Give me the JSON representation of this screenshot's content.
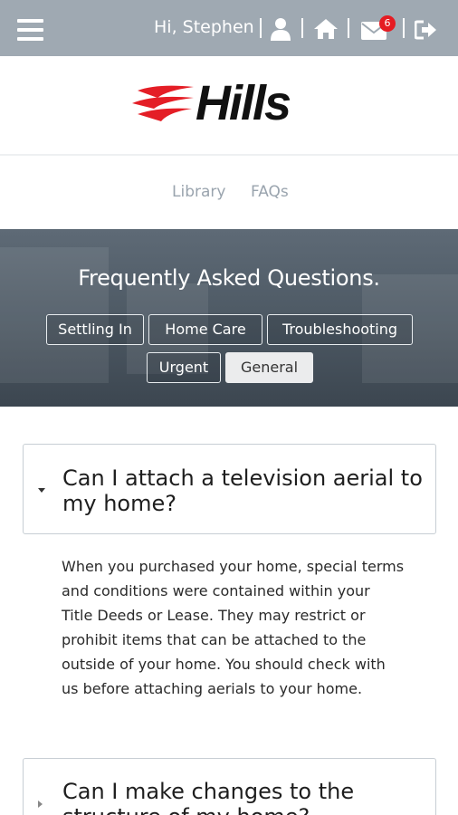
{
  "topbar": {
    "greeting": "Hi, Stephen",
    "separator": "|",
    "icons": [
      "menu-icon",
      "user-icon",
      "home-icon",
      "mail-icon",
      "logout-icon"
    ],
    "mail_badge_count": "6",
    "background_color": "#9fa9b2",
    "badge_color": "#e51c23"
  },
  "brand": {
    "logo_text": "Hills",
    "accent_color": "#e41e26"
  },
  "subnav": {
    "items": [
      {
        "label": "Library"
      },
      {
        "label": "FAQs"
      }
    ]
  },
  "hero": {
    "title": "Frequently Asked Questions.",
    "tags": [
      {
        "label": "Settling In",
        "active": false
      },
      {
        "label": "Home Care",
        "active": false
      },
      {
        "label": "Troubleshooting",
        "active": false
      },
      {
        "label": "Urgent",
        "active": false
      },
      {
        "label": "General",
        "active": true
      }
    ]
  },
  "faqs": [
    {
      "question": "Can I attach a television aerial to my home?",
      "expanded": true,
      "answer": "When you purchased your home, special terms and conditions were contained within your Title Deeds or Lease.  They may restrict or prohibit items that can be attached to the outside of your home.  You should check with us before attaching aerials to your home."
    },
    {
      "question": "Can I make changes to the structure of my home?",
      "expanded": false
    }
  ]
}
